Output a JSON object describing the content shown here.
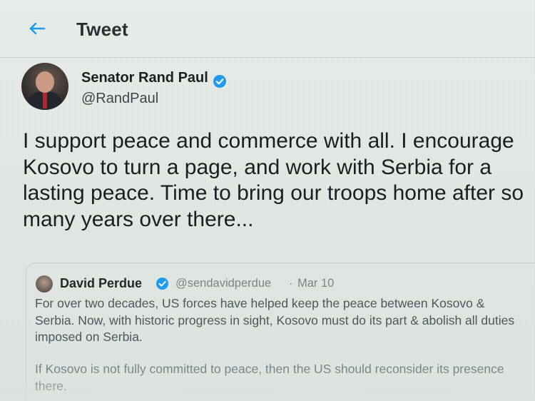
{
  "header": {
    "title": "Tweet"
  },
  "tweet": {
    "author_name": "Senator Rand Paul",
    "author_handle": "@RandPaul",
    "text": "I support peace and commerce with all. I encourage Kosovo to turn a page, and work with Serbia for a lasting peace. Time to bring our troops home after so many years over there..."
  },
  "quoted_tweet": {
    "author_name": "David Perdue",
    "author_handle": "@sendavidperdue",
    "separator": "·",
    "date": "Mar 10",
    "paragraph_1": "For over two decades, US forces have helped keep the peace between Kosovo & Serbia. Now, with historic progress in sight, Kosovo must do its part & abolish all duties imposed on Serbia.",
    "paragraph_2": "If Kosovo is not fully committed to peace, then the US should reconsider its presence there."
  },
  "colors": {
    "accent": "#1d9bf0",
    "verified": "#1d9bf0"
  },
  "icons": {
    "back": "arrow-left-icon",
    "verified": "verified-badge-icon"
  }
}
